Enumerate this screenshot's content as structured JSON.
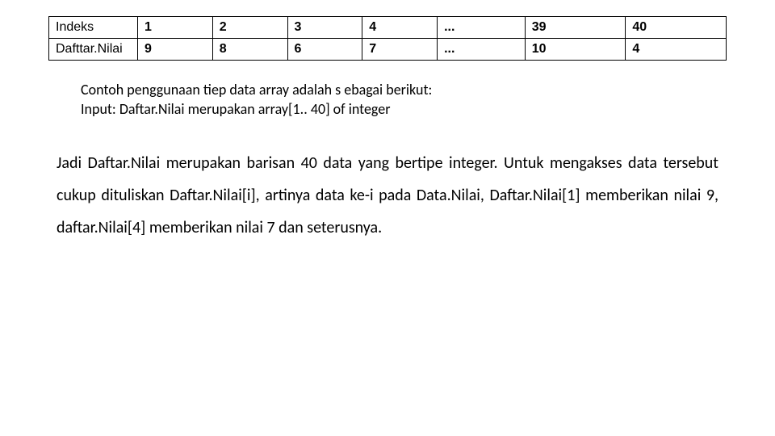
{
  "table": {
    "row1": {
      "label": "Indeks",
      "c1": "1",
      "c2": "2",
      "c3": "3",
      "c4": "4",
      "c5": "...",
      "c6": "39",
      "c7": "40"
    },
    "row2": {
      "label": "Dafttar.Nilai",
      "c1": "9",
      "c2": "8",
      "c3": "6",
      "c4": "7",
      "c5": "...",
      "c6": "10",
      "c7": "4"
    }
  },
  "note": {
    "line1": "Contoh penggunaan tiep data array adalah s ebagai berikut:",
    "line2": "Input: Daftar.Nilai merupakan array[1.. 40] of integer"
  },
  "paragraph": "Jadi Daftar.Nilai merupakan barisan 40 data yang bertipe integer. Untuk mengakses data tersebut cukup dituliskan Daftar.Nilai[i], artinya data ke-i pada Data.Nilai, Daftar.Nilai[1] memberikan nilai 9, daftar.Nilai[4] memberikan nilai 7 dan seterusnya."
}
